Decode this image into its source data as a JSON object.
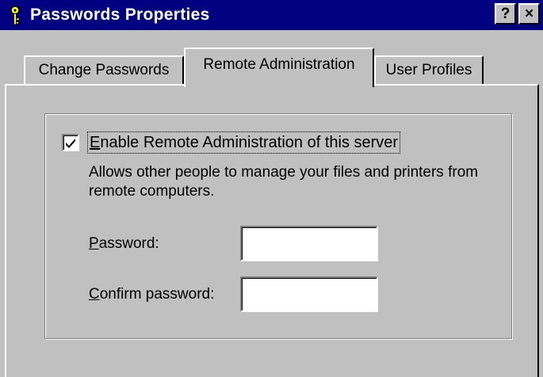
{
  "window": {
    "title": "Passwords Properties",
    "help_button": "?",
    "close_button": "×"
  },
  "tabs": [
    {
      "label": "Change Passwords",
      "active": false
    },
    {
      "label": "Remote Administration",
      "active": true
    },
    {
      "label": "User Profiles",
      "active": false
    }
  ],
  "remote_admin": {
    "enable_checkbox": {
      "checked": true,
      "accel": "E",
      "label_rest": "nable Remote Administration of this server"
    },
    "description": "Allows other people to manage your files and printers from remote computers.",
    "password": {
      "accel": "P",
      "label_rest": "assword:",
      "value": ""
    },
    "confirm_password": {
      "accel": "C",
      "label_rest": "onfirm password:",
      "value": ""
    }
  },
  "colors": {
    "titlebar": "#000080",
    "face": "#c0c0c0",
    "field": "#ffffff"
  },
  "icons": {
    "title": "key-icon",
    "checkbox_mark": "checkmark-icon"
  }
}
